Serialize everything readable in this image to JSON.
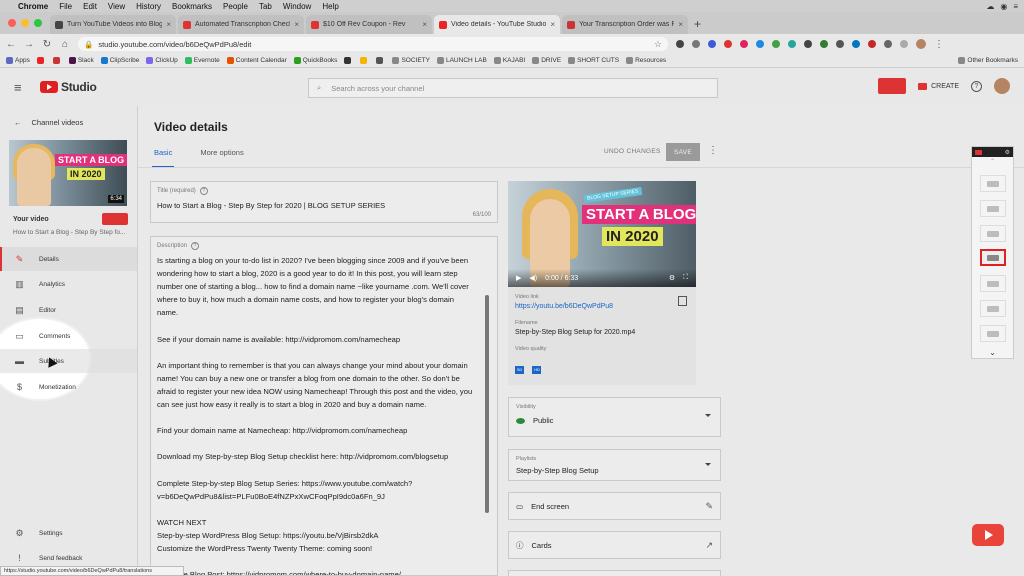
{
  "mac_menu": [
    "Chrome",
    "File",
    "Edit",
    "View",
    "History",
    "Bookmarks",
    "People",
    "Tab",
    "Window",
    "Help"
  ],
  "tabs": [
    {
      "title": "Turn YouTube Videos into Blog P",
      "color": "#444"
    },
    {
      "title": "Automated Transcription Checko",
      "color": "#d33"
    },
    {
      "title": "$10 Off Rev Coupon - Rev",
      "color": "#d33"
    },
    {
      "title": "Video details - YouTube Studio",
      "color": "#e22"
    },
    {
      "title": "Your Transcription Order was Re",
      "color": "#c33"
    }
  ],
  "address": {
    "url": "studio.youtube.com/video/b6DeQwPdPu8/edit"
  },
  "bookmarks": [
    {
      "label": "Apps"
    },
    {
      "label": ""
    },
    {
      "label": ""
    },
    {
      "label": "Slack"
    },
    {
      "label": "ClipScribe"
    },
    {
      "label": "ClickUp"
    },
    {
      "label": "Evernote"
    },
    {
      "label": "Content Calendar"
    },
    {
      "label": "QuickBooks"
    },
    {
      "label": ""
    },
    {
      "label": ""
    },
    {
      "label": ""
    },
    {
      "label": "SOCIETY"
    },
    {
      "label": "LAUNCH LAB"
    },
    {
      "label": "KAJABI"
    },
    {
      "label": "DRIVE"
    },
    {
      "label": "SHORT CUTS"
    },
    {
      "label": "Resources"
    }
  ],
  "other_bookmarks": "Other Bookmarks",
  "studio": {
    "logo_text": "Studio",
    "search_placeholder": "Search across your channel",
    "create_label": "CREATE"
  },
  "sidebar": {
    "back_label": "Channel videos",
    "thumb_line1": "START A BLOG",
    "thumb_line2": "IN 2020",
    "duration": "6:34",
    "your_video": "Your video",
    "video_title": "How to Start a Blog - Step By Step fo...",
    "items": [
      {
        "label": "Details",
        "icon": "pencil-icon"
      },
      {
        "label": "Analytics",
        "icon": "analytics-icon"
      },
      {
        "label": "Editor",
        "icon": "film-icon"
      },
      {
        "label": "Comments",
        "icon": "comment-icon"
      },
      {
        "label": "Subtitles",
        "icon": "subtitles-icon"
      },
      {
        "label": "Monetization",
        "icon": "dollar-icon"
      }
    ],
    "settings_label": "Settings",
    "feedback_label": "Send feedback"
  },
  "main": {
    "title": "Video details",
    "tabs": [
      "Basic",
      "More options"
    ],
    "undo_label": "UNDO CHANGES",
    "save_label": "SAVE",
    "title_field_label": "Title (required)",
    "title_value": "How to Start a Blog - Step By Step for 2020 | BLOG SETUP SERIES",
    "title_count": "63/100",
    "desc_label": "Description",
    "description": "Is starting a blog on your to-do list in 2020? I've been blogging since 2009 and if you've been\nwondering how to start a blog, 2020 is a good year to do it! In this post, you will learn step\nnumber one of starting a blog... how to find a domain name ~like yourname .com. We'll cover\nwhere to buy it, how much a domain name costs, and how to register your blog's domain\nname.\n\nSee if your domain name is available: http://vidpromom.com/namecheap\n\nAn important thing to remember is that you can always change your mind about your domain\nname! You can buy a new one or transfer a blog from one domain to the other. So don't be\nafraid to register your new idea NOW using Namecheap! Through this post and the video, you\ncan see just how easy it really is to start a blog in 2020 and buy a domain name.\n\nFind your domain name at Namecheap: http://vidpromom.com/namecheap\n\nDownload my Step-by-step Blog Setup checklist here: http://vidpromom.com/blogsetup\n\nComplete Step-by-step Blog Setup Series: https://www.youtube.com/watch?\nv=b6DeQwPdPu8&list=PLFu0BoE4fNZPxXwCFoqPpI9dc0a6Fn_9J\n\nWATCH NEXT\nStep-by-step WordPress Blog Setup: https://youtu.be/VjBirsb2dkA\nCustomize the WordPress Twenty Twenty Theme: coming soon!\n\nRead the Blog Post: https://vidpromom.com/where-to-buy-domain-name/"
  },
  "player": {
    "sticker": "BLOG SETUP SERIES",
    "line1": "START A BLOG",
    "line2": "IN 2020",
    "time": "0:00 / 6:33"
  },
  "info": {
    "link_label": "Video link",
    "link_value": "https://youtu.be/b6DeQwPdPu8",
    "filename_label": "Filename",
    "filename_value": "Step-by-Step Blog Setup for 2020.mp4",
    "quality_label": "Video quality",
    "quality_badges": [
      "SD",
      "HD"
    ]
  },
  "visibility": {
    "label": "Visibility",
    "value": "Public"
  },
  "playlists": {
    "label": "Playlists",
    "value": "Step-by-Step Blog Setup"
  },
  "end_screen": "End screen",
  "cards": "Cards",
  "status_url": "https://studio.youtube.com/video/b6DeQwPdPu8/translations",
  "colors": {
    "accent": "#1a65c6",
    "brand_red": "#e02020",
    "active_nav": "#d33"
  }
}
